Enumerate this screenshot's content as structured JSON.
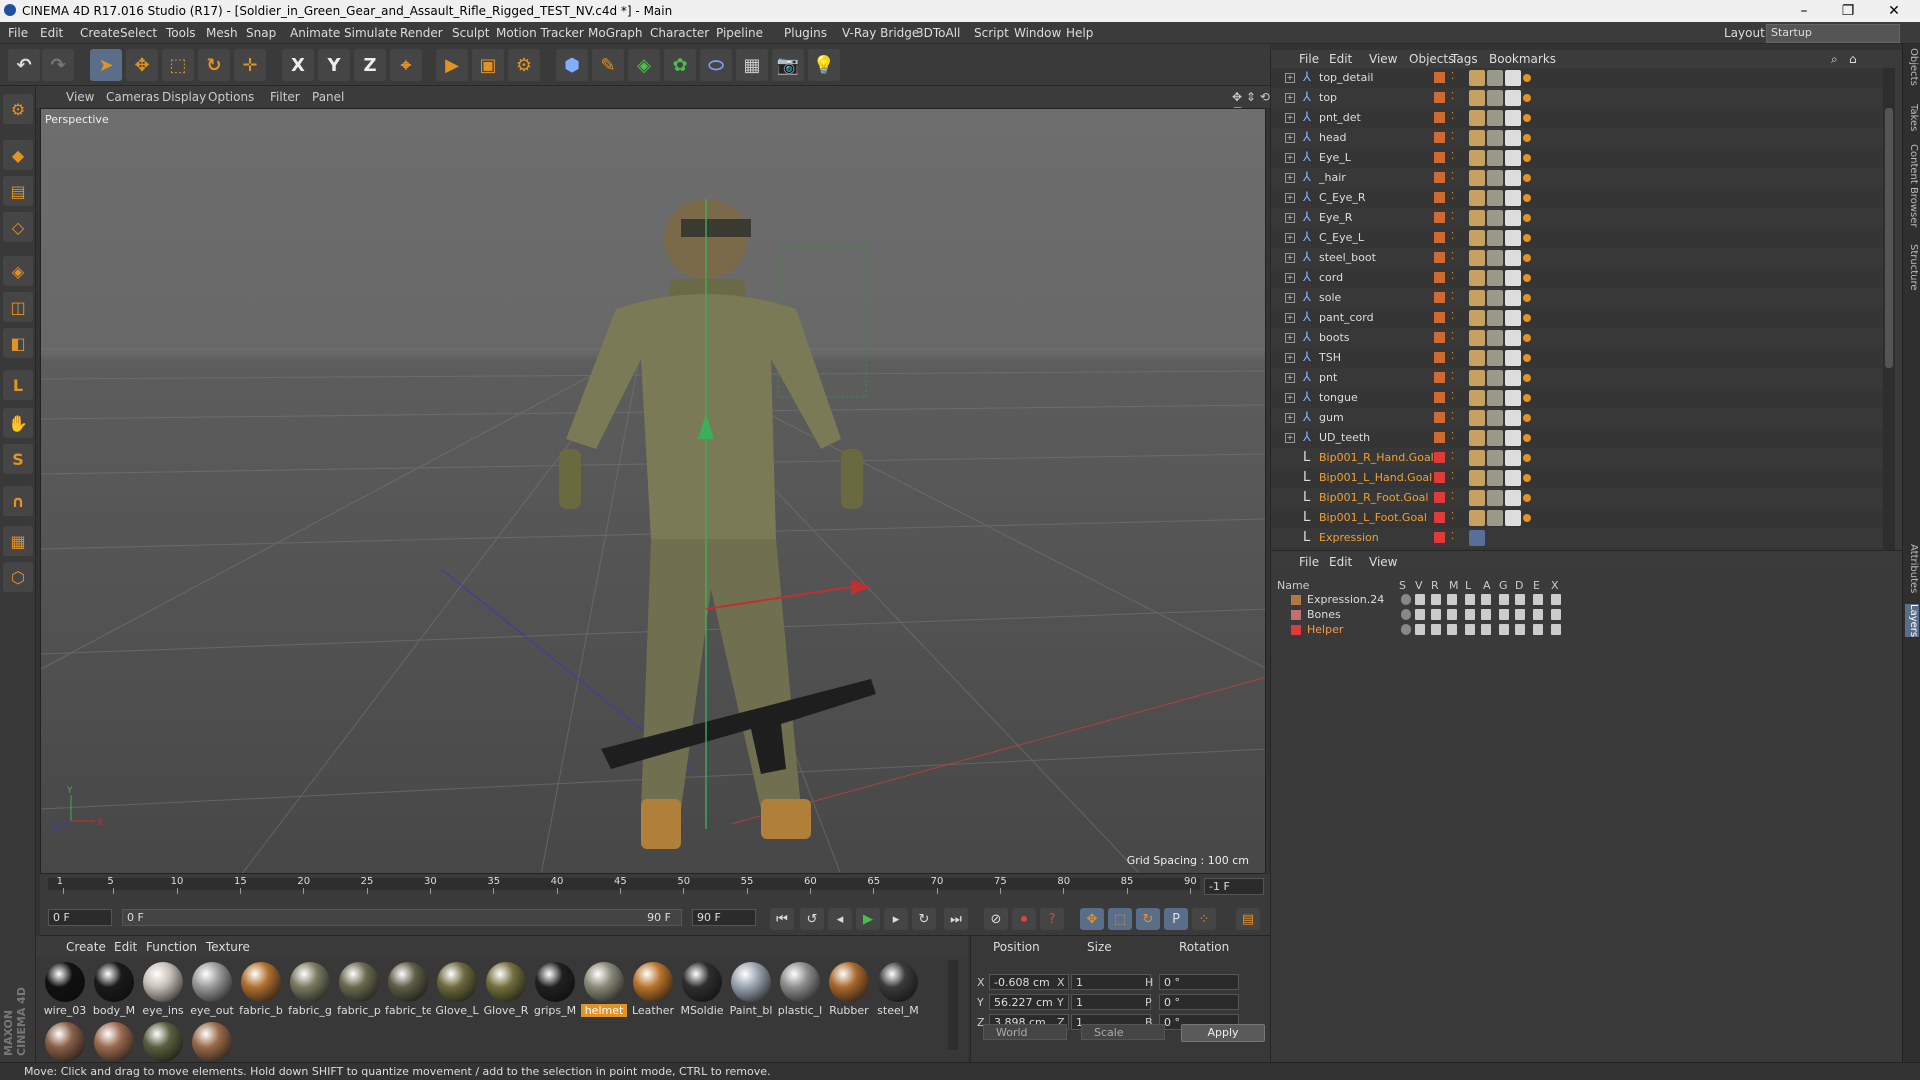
{
  "window": {
    "title": "CINEMA 4D R17.016 Studio (R17) - [Soldier_in_Green_Gear_and_Assault_Rifle_Rigged_TEST_NV.c4d *] - Main",
    "controls": [
      "–",
      "❐",
      "✕"
    ]
  },
  "menubar": {
    "items": [
      "File",
      "Edit",
      "Create",
      "Select",
      "Tools",
      "Mesh",
      "Snap",
      "Animate",
      "Simulate",
      "Render",
      "Sculpt",
      "Motion Tracker",
      "MoGraph",
      "Character",
      "Pipeline",
      "Plugins",
      "V-Ray Bridge",
      "3DToAll",
      "Script",
      "Window",
      "Help"
    ],
    "layout_label": "Layout:",
    "layout_value": "Startup"
  },
  "toolbar": {
    "icons": [
      "undo-icon",
      "redo-icon",
      "select-icon",
      "move-icon",
      "scale-icon",
      "rotate-icon",
      "live-select-icon",
      "x-axis-icon",
      "y-axis-icon",
      "z-axis-icon",
      "coordinate-system-icon",
      "render-view-icon",
      "render-picture-viewer-icon",
      "edit-render-settings-icon",
      "cube-icon",
      "pen-icon",
      "subdivision-icon",
      "cloner-icon",
      "deformer-icon",
      "floor-icon",
      "camera-icon",
      "light-icon"
    ],
    "glyphs": [
      "↶",
      "↷",
      "➤",
      "✥",
      "⬚",
      "↻",
      "✛",
      "X",
      "Y",
      "Z",
      "⌖",
      "▶",
      "▣",
      "⚙",
      "⬢",
      "✎",
      "◈",
      "✿",
      "⬭",
      "▦",
      "📷",
      "💡"
    ]
  },
  "left_tools": {
    "icons": [
      "make-editable-icon",
      "model-mode-icon",
      "texture-mode-icon",
      "workplane-icon",
      "points-mode-icon",
      "edges-mode-icon",
      "polygons-mode-icon",
      "axis-mode-icon",
      "tweak-mode-icon",
      "snap-icon",
      "magnet-icon",
      "workplane-lock-icon",
      "grid-snap-icon"
    ],
    "glyphs": [
      "⚙",
      "◆",
      "▤",
      "◇",
      "◈",
      "◫",
      "◧",
      "L",
      "✋",
      "S",
      "∩",
      "▦",
      "⬡"
    ]
  },
  "viewport": {
    "menu": [
      "View",
      "Cameras",
      "Display",
      "Options",
      "Filter",
      "Panel"
    ],
    "camera_label": "Perspective",
    "grid_info": "Grid Spacing : 100 cm",
    "axis_labels": [
      "Y",
      "X",
      "Z"
    ]
  },
  "timeline": {
    "ticks": [
      "1",
      "5",
      "10",
      "15",
      "20",
      "25",
      "30",
      "35",
      "40",
      "45",
      "50",
      "55",
      "60",
      "65",
      "70",
      "75",
      "80",
      "85",
      "90"
    ],
    "end_field": "-1 F",
    "current_frame": "0 F",
    "range_start": "0 F",
    "range_end": "90 F",
    "max_frame": "90 F"
  },
  "material_manager": {
    "menu": [
      "Create",
      "Edit",
      "Function",
      "Texture"
    ],
    "materials": [
      {
        "label": "wire_03",
        "color": "#111111"
      },
      {
        "label": "body_M",
        "color": "#1a1a1a"
      },
      {
        "label": "eye_ins",
        "color": "#c8c0b8"
      },
      {
        "label": "eye_out",
        "color": "#9a9a9a"
      },
      {
        "label": "fabric_b",
        "color": "#b07030"
      },
      {
        "label": "fabric_g",
        "color": "#7a7a60"
      },
      {
        "label": "fabric_p",
        "color": "#6a6a50"
      },
      {
        "label": "fabric_te",
        "color": "#5e5e48"
      },
      {
        "label": "Glove_L",
        "color": "#6e6a40"
      },
      {
        "label": "Glove_R",
        "color": "#74703e"
      },
      {
        "label": "grips_M",
        "color": "#202020"
      },
      {
        "label": "helmet",
        "color": "#8a8a7a"
      },
      {
        "label": "Leather",
        "color": "#b8742c"
      },
      {
        "label": "MSoldie",
        "color": "#2e2e2e"
      },
      {
        "label": "Paint_bl",
        "color": "#9aa4b0"
      },
      {
        "label": "plastic_l",
        "color": "#8e8e8e"
      },
      {
        "label": "Rubber",
        "color": "#a86a30"
      },
      {
        "label": "steel_M",
        "color": "#3a3a3a"
      },
      {
        "label": "",
        "color": "#8a6048"
      },
      {
        "label": "",
        "color": "#9a6a50"
      },
      {
        "label": "",
        "color": "#5a6040"
      },
      {
        "label": "",
        "color": "#9a6a4a"
      }
    ],
    "selected": "helmet"
  },
  "coordinates": {
    "headers": [
      "Position",
      "Size",
      "Rotation"
    ],
    "position": [
      {
        "axis": "X",
        "value": "-0.608 cm"
      },
      {
        "axis": "Y",
        "value": "56.227 cm"
      },
      {
        "axis": "Z",
        "value": "3.898 cm"
      }
    ],
    "size": [
      {
        "axis": "X",
        "value": "1"
      },
      {
        "axis": "Y",
        "value": "1"
      },
      {
        "axis": "Z",
        "value": "1"
      }
    ],
    "rotation": [
      {
        "axis": "H",
        "value": "0 °"
      },
      {
        "axis": "P",
        "value": "0 °"
      },
      {
        "axis": "B",
        "value": "0 °"
      }
    ],
    "mode_world": "World",
    "mode_scale": "Scale",
    "apply": "Apply"
  },
  "object_manager": {
    "menu": [
      "File",
      "Edit",
      "View",
      "Objects",
      "Tags",
      "Bookmarks"
    ],
    "objects": [
      {
        "name": "top_detail",
        "type": "bone",
        "goal": false
      },
      {
        "name": "top",
        "type": "bone",
        "goal": false
      },
      {
        "name": "pnt_det",
        "type": "bone",
        "goal": false
      },
      {
        "name": "head",
        "type": "bone",
        "goal": false
      },
      {
        "name": "Eye_L",
        "type": "bone",
        "goal": false
      },
      {
        "name": "_hair",
        "type": "bone",
        "goal": false
      },
      {
        "name": "C_Eye_R",
        "type": "bone",
        "goal": false
      },
      {
        "name": "Eye_R",
        "type": "bone",
        "goal": false
      },
      {
        "name": "C_Eye_L",
        "type": "bone",
        "goal": false
      },
      {
        "name": "steel_boot",
        "type": "bone",
        "goal": false
      },
      {
        "name": "cord",
        "type": "bone",
        "goal": false
      },
      {
        "name": "sole",
        "type": "bone",
        "goal": false
      },
      {
        "name": "pant_cord",
        "type": "bone",
        "goal": false
      },
      {
        "name": "boots",
        "type": "bone",
        "goal": false
      },
      {
        "name": "TSH",
        "type": "bone",
        "goal": false
      },
      {
        "name": "pnt",
        "type": "bone",
        "goal": false
      },
      {
        "name": "tongue",
        "type": "bone",
        "goal": false
      },
      {
        "name": "gum",
        "type": "bone",
        "goal": false
      },
      {
        "name": "UD_teeth",
        "type": "bone",
        "goal": false
      },
      {
        "name": "Bip001_R_Hand.Goal",
        "type": "null",
        "goal": true
      },
      {
        "name": "Bip001_L_Hand.Goal",
        "type": "null",
        "goal": true
      },
      {
        "name": "Bip001_R_Foot.Goal",
        "type": "null",
        "goal": true
      },
      {
        "name": "Bip001_L_Foot.Goal",
        "type": "null",
        "goal": true
      },
      {
        "name": "Expression",
        "type": "null",
        "goal": true
      }
    ]
  },
  "layer_manager": {
    "menu": [
      "File",
      "Edit",
      "View"
    ],
    "headers": [
      "Name",
      "S",
      "V",
      "R",
      "M",
      "L",
      "A",
      "G",
      "D",
      "E",
      "X"
    ],
    "layers": [
      {
        "name": "Expression.24",
        "color": "#b07a40",
        "text_color": "#dddddd"
      },
      {
        "name": "Bones",
        "color": "#c07070",
        "text_color": "#dddddd"
      },
      {
        "name": "Helper",
        "color": "#e03a3a",
        "text_color": "#ff9a3a"
      }
    ]
  },
  "side_tabs": [
    "Objects",
    "Takes",
    "Content Browser",
    "Structure",
    "Attributes",
    "Layers"
  ],
  "status": {
    "text": "Move: Click and drag to move elements. Hold down SHIFT to quantize movement / add to the selection in point mode, CTRL to remove."
  },
  "logo_text": "MAXON CINEMA 4D",
  "colors": {
    "accent": "#e39224",
    "goal_text": "#f0a030",
    "selection": "#5a6e8a"
  }
}
